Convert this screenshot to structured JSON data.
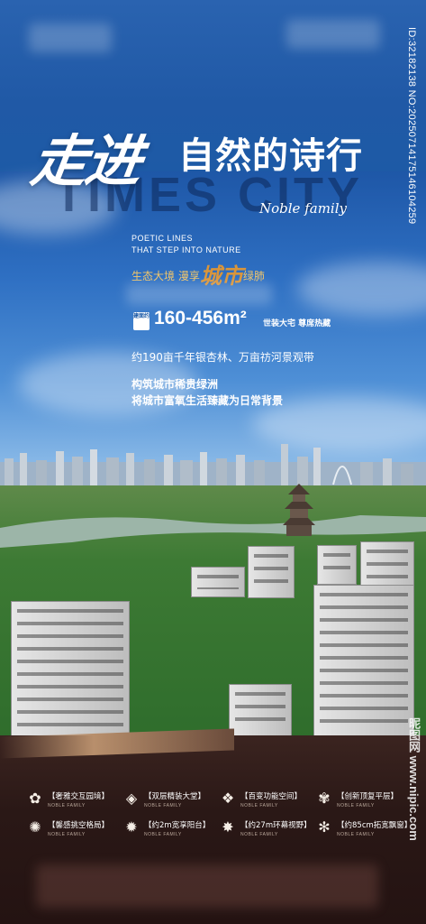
{
  "title": {
    "main": "走进",
    "sub": "自然的诗行"
  },
  "background_word": "TIMES CITY",
  "script_brand": "Noble family",
  "poetic": {
    "line1": "POETIC LINES",
    "line2": "THAT STEP INTO NATURE"
  },
  "eco": {
    "prefix": "生态大境  漫享",
    "highlight": "城市",
    "suffix": "绿肺"
  },
  "area": {
    "badge": "建面约",
    "range": "160-456m²",
    "sub": "世装大宅 尊席热藏"
  },
  "copy": {
    "line1": "约190亩千年银杏林、万亩祊河景观带",
    "line2": "构筑城市稀贵绿洲",
    "line3": "将城市富氧生活臻藏为日常背景"
  },
  "features": [
    {
      "icon": "flower-icon",
      "glyph": "✿",
      "title": "【奢雅交互园境】",
      "sub": "NOBLE FAMILY"
    },
    {
      "icon": "diamond-icon",
      "glyph": "◈",
      "title": "【双层精装大堂】",
      "sub": "NOBLE FAMILY"
    },
    {
      "icon": "pinwheel-icon",
      "glyph": "❖",
      "title": "【百变功能空间】",
      "sub": "NOBLE FAMILY"
    },
    {
      "icon": "lotus-icon",
      "glyph": "✾",
      "title": "【创新顶复平层】",
      "sub": "NOBLE FAMILY"
    },
    {
      "icon": "swirl-icon",
      "glyph": "✺",
      "title": "【馨感挑空格局】",
      "sub": "NOBLE FAMILY"
    },
    {
      "icon": "star-icon",
      "glyph": "✹",
      "title": "【约2m宽享阳台】",
      "sub": "NOBLE FAMILY"
    },
    {
      "icon": "sun-icon",
      "glyph": "✸",
      "title": "【约27m环幕视野】",
      "sub": "NOBLE FAMILY"
    },
    {
      "icon": "snowflake-icon",
      "glyph": "✻",
      "title": "【约85cm拓宽飘窗】",
      "sub": "NOBLE FAMILY"
    }
  ],
  "side_id": "ID:32182138 NO:20250714175146104259",
  "watermark": "昵图网 www.nipic.com",
  "colors": {
    "blue": "#1d5aa6",
    "gold": "#d9953a",
    "dark": "#2a1816"
  }
}
